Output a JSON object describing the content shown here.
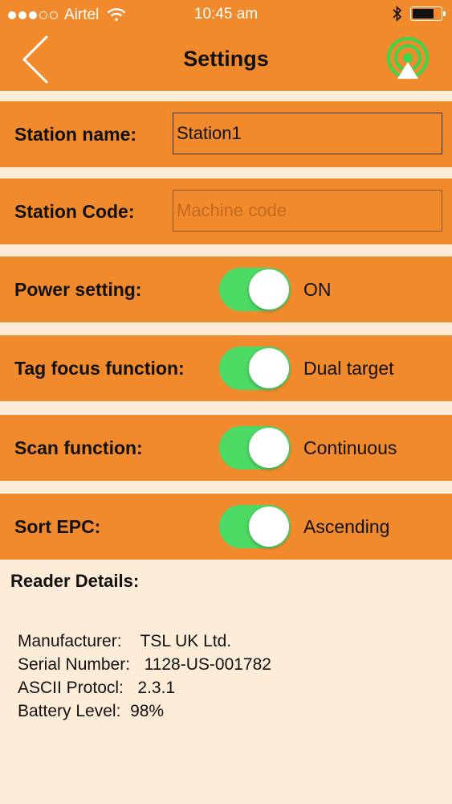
{
  "statusbar": {
    "carrier": "Airtel",
    "time": "10:45 am",
    "signal_dots": [
      true,
      true,
      true,
      false,
      false
    ],
    "battery_level": 0.75
  },
  "navbar": {
    "title": "Settings",
    "back_icon": "chevron-left-icon",
    "right_icon": "wireless-signal-icon",
    "signal_color": "#3bd64a"
  },
  "colors": {
    "accent": "#f08a2c",
    "background": "#fcecd8",
    "toggle_on": "#4cd964"
  },
  "settings": {
    "station_name": {
      "label": "Station name:",
      "value": "Station1"
    },
    "station_code": {
      "label": "Station Code:",
      "value": "",
      "placeholder": "Machine code"
    },
    "power": {
      "label": "Power setting:",
      "on": true,
      "value": "ON"
    },
    "tag_focus": {
      "label": "Tag focus function:",
      "on": true,
      "value": "Dual target"
    },
    "scan": {
      "label": "Scan function:",
      "on": true,
      "value": "Continuous"
    },
    "sort_epc": {
      "label": "Sort EPC:",
      "on": true,
      "value": "Ascending"
    }
  },
  "reader": {
    "title": "Reader Details:",
    "manufacturer": {
      "label": "Manufacturer:",
      "value": "TSL UK Ltd."
    },
    "serial": {
      "label": "Serial Number:",
      "value": "1128-US-001782"
    },
    "protocol": {
      "label": "ASCII Protocl:",
      "value": "2.3.1"
    },
    "battery": {
      "label": "Battery Level:",
      "value": "98%"
    }
  }
}
